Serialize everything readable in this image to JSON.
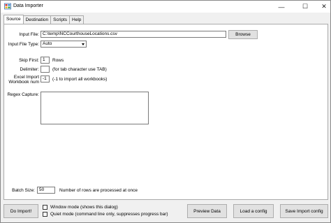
{
  "window": {
    "title": "Data Importer",
    "minimize": "—",
    "maximize": "☐",
    "close": "✕"
  },
  "tabs": [
    {
      "label": "Source",
      "active": true
    },
    {
      "label": "Destination",
      "active": false
    },
    {
      "label": "Scripts",
      "active": false
    },
    {
      "label": "Help",
      "active": false
    }
  ],
  "source": {
    "input_file_label": "Input File:",
    "input_file_value": "C:\\temp\\NCCourthouseLocations.csv",
    "browse_label": "Browse",
    "input_file_type_label": "Input File Type:",
    "input_file_type_value": "Auto",
    "skip_first_label": "Skip First:",
    "skip_first_value": "1",
    "skip_first_suffix": "Rows",
    "delimiter_label": "Delimiter:",
    "delimiter_value": "",
    "delimiter_hint": "(for tab character use TAB)",
    "excel_import_label_1": "Excel Import",
    "excel_import_label_2": "Workbook num",
    "excel_import_value": "-1",
    "excel_import_hint": "(-1 to import all workbooks)",
    "regex_label": "Regex Capture:",
    "regex_value": "",
    "batch_size_label": "Batch Size:",
    "batch_size_value": "50",
    "batch_size_hint": "Number of rows are processed at once"
  },
  "footer": {
    "do_import_label": "Do Import!",
    "window_mode_label": "Window mode (shows this dialog)",
    "quiet_mode_label": "Quiet mode (command line only, suppresses progress bar)",
    "preview_label": "Preview Data",
    "load_config_label": "Load a config",
    "save_config_label": "Save Import config"
  },
  "colors": {
    "window_bg": "#f0f0f0",
    "panel_bg": "#ffffff",
    "button_bg": "#e1e1e1"
  }
}
